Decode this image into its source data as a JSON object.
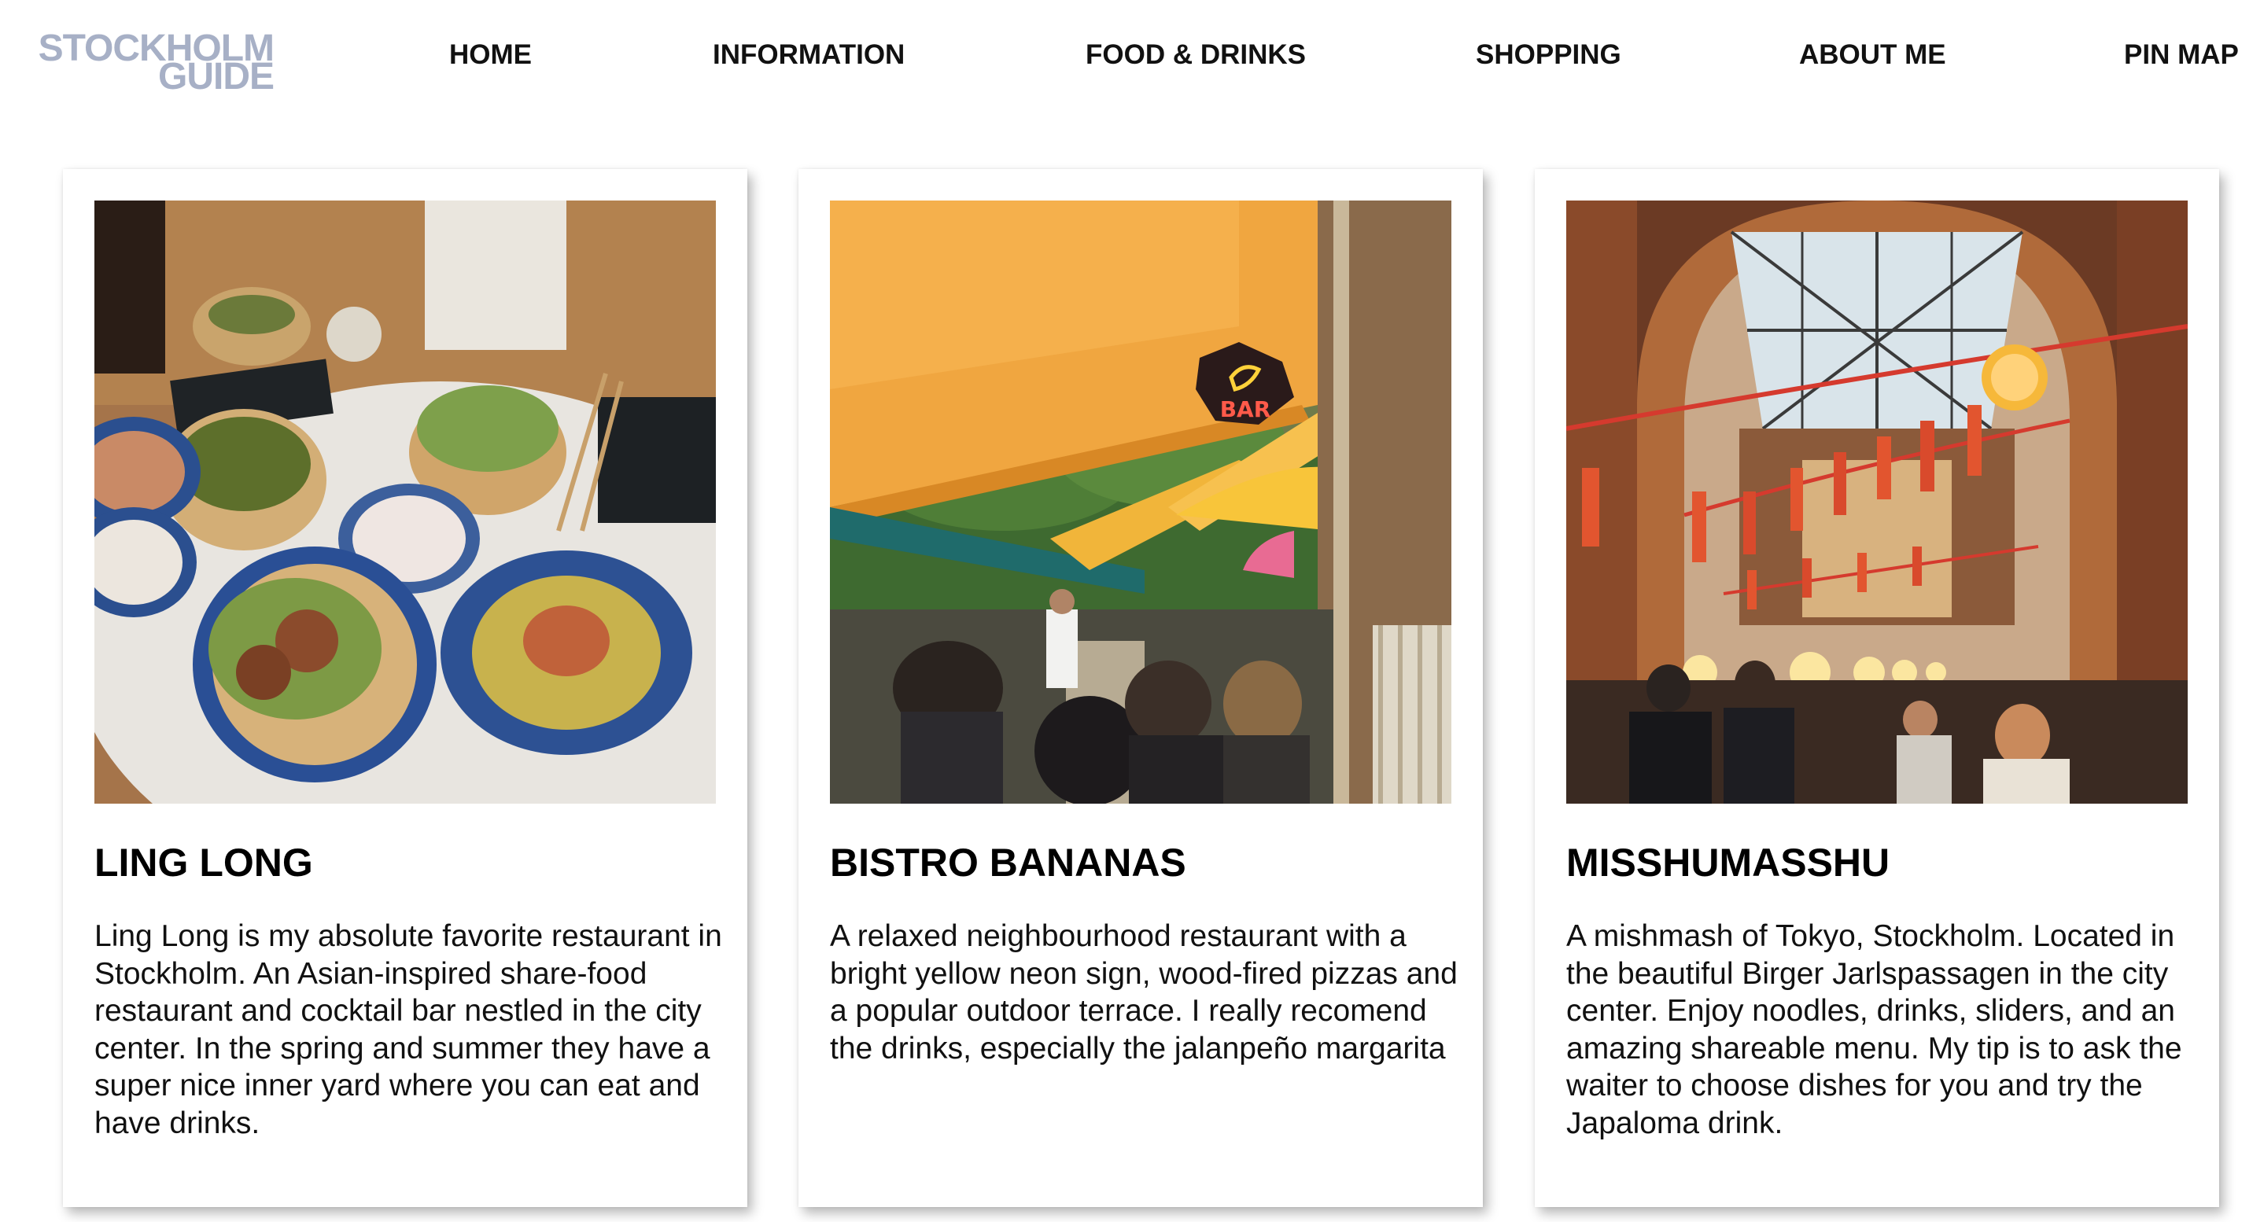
{
  "site": {
    "logo_line1": "STOCKHOLM",
    "logo_line2": "GUIDE",
    "logo_color": "#a7b0c6"
  },
  "nav": {
    "items": [
      {
        "label": "HOME"
      },
      {
        "label": "INFORMATION"
      },
      {
        "label": "FOOD & DRINKS"
      },
      {
        "label": "SHOPPING"
      },
      {
        "label": "ABOUT ME"
      },
      {
        "label": "PIN MAP"
      }
    ]
  },
  "cards": [
    {
      "title": "LING LONG",
      "description": "Ling Long is my absolute favorite restaurant in Stockholm. An Asian-inspired share-food restaurant and cocktail bar nestled in the city center. In the spring and summer they have a super nice inner yard where you can eat and have drinks."
    },
    {
      "title": "BISTRO BANANAS",
      "description": "A relaxed neighbourhood restaurant with a bright yellow neon sign, wood-fired pizzas and a popular outdoor terrace. I really recomend the drinks, especially the jalanpeño margarita",
      "sign_text": "BAR"
    },
    {
      "title": "MISSHUMASSHU",
      "description": "A mishmash of Tokyo, Stockholm. Located in the beautiful Birger Jarlspassagen in the city center. Enjoy noodles, drinks, sliders, and an amazing shareable menu. My tip is to ask the waiter to choose dishes for you and try the Japaloma drink."
    }
  ]
}
